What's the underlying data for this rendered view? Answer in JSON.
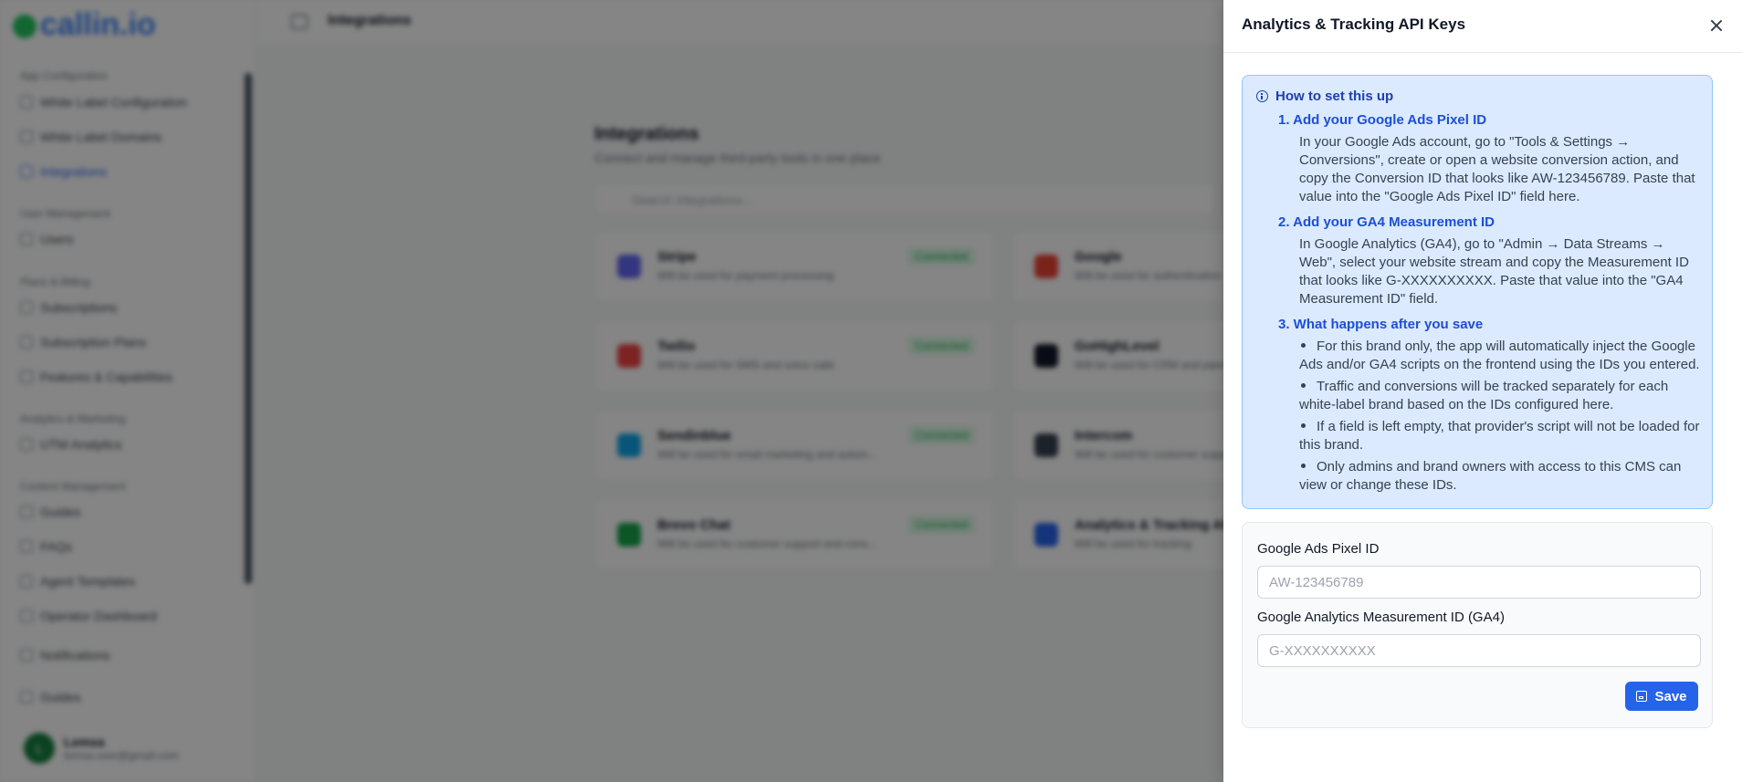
{
  "background": {
    "logo": "callin.io",
    "header_title": "Integrations",
    "sidebar": {
      "sections": [
        {
          "label": "App Configuration",
          "items": [
            "White Label Configuration",
            "White Label Domains",
            "Integrations"
          ]
        },
        {
          "label": "User Management",
          "items": [
            "Users"
          ]
        },
        {
          "label": "Plans & Billing",
          "items": [
            "Subscriptions",
            "Subscription Plans",
            "Features & Capabilities"
          ]
        },
        {
          "label": "Analytics & Marketing",
          "items": [
            "UTM Analytics"
          ]
        },
        {
          "label": "Content Management",
          "items": [
            "Guides",
            "FAQs",
            "Agent Templates",
            "Operator Dashboard"
          ]
        }
      ],
      "extra_items": [
        "Notifications",
        "Guides"
      ],
      "user_name": "Lemsa",
      "user_email": "lemsa.user@gmail.com",
      "user_initial": "L"
    },
    "main": {
      "title": "Integrations",
      "subtitle": "Connect and manage third-party tools in one place",
      "search_placeholder": "Search integrations...",
      "cards": [
        {
          "name": "Stripe",
          "desc": "Will be used for payment processing",
          "badge": "Connected",
          "color": "#6366f1"
        },
        {
          "name": "Google",
          "desc": "Will be used for authentication",
          "badge": "",
          "color": "#ea4335"
        },
        {
          "name": "Twilio",
          "desc": "Will be used for SMS and voice calls",
          "badge": "Connected",
          "color": "#ef4444"
        },
        {
          "name": "GoHighLevel",
          "desc": "Will be used for CRM and pipelines",
          "badge": "",
          "color": "#111827"
        },
        {
          "name": "Sendinblue",
          "desc": "Will be used for email marketing and autom...",
          "badge": "Connected",
          "color": "#0ea5e9"
        },
        {
          "name": "Intercom",
          "desc": "Will be used for customer support",
          "badge": "",
          "color": "#374151"
        },
        {
          "name": "Brevo Chat",
          "desc": "Will be used for customer support and conv...",
          "badge": "Connected",
          "color": "#16a34a"
        },
        {
          "name": "Analytics & Tracking API Keys",
          "desc": "Will be used for tracking",
          "badge": "",
          "color": "#2563eb"
        }
      ]
    }
  },
  "panel": {
    "title": "Analytics & Tracking API Keys",
    "info": {
      "heading": "How to set this up",
      "steps": [
        {
          "title": "1. Add your Google Ads Pixel ID",
          "body": "In your Google Ads account, go to \"Tools & Settings → Conversions\", create or open a website conversion action, and copy the Conversion ID that looks like AW-123456789. Paste that value into the \"Google Ads Pixel ID\" field here."
        },
        {
          "title": "2. Add your GA4 Measurement ID",
          "body": "In Google Analytics (GA4), go to \"Admin → Data Streams → Web\", select your website stream and copy the Measurement ID that looks like G-XXXXXXXXXX. Paste that value into the \"GA4 Measurement ID\" field."
        },
        {
          "title": "3. What happens after you save",
          "bullets": [
            "For this brand only, the app will automatically inject the Google Ads and/or GA4 scripts on the frontend using the IDs you entered.",
            "Traffic and conversions will be tracked separately for each white-label brand based on the IDs configured here.",
            "If a field is left empty, that provider's script will not be loaded for this brand.",
            "Only admins and brand owners with access to this CMS can view or change these IDs."
          ]
        }
      ]
    },
    "form": {
      "ads_label": "Google Ads Pixel ID",
      "ads_placeholder": "AW-123456789",
      "ads_value": "",
      "ga4_label": "Google Analytics Measurement ID (GA4)",
      "ga4_placeholder": "G-XXXXXXXXXX",
      "ga4_value": "",
      "save_label": "Save"
    }
  },
  "colors": {
    "accent": "#2563eb",
    "info_bg": "#dbeafe",
    "info_border": "#93c5fd",
    "info_text": "#1e40af"
  }
}
